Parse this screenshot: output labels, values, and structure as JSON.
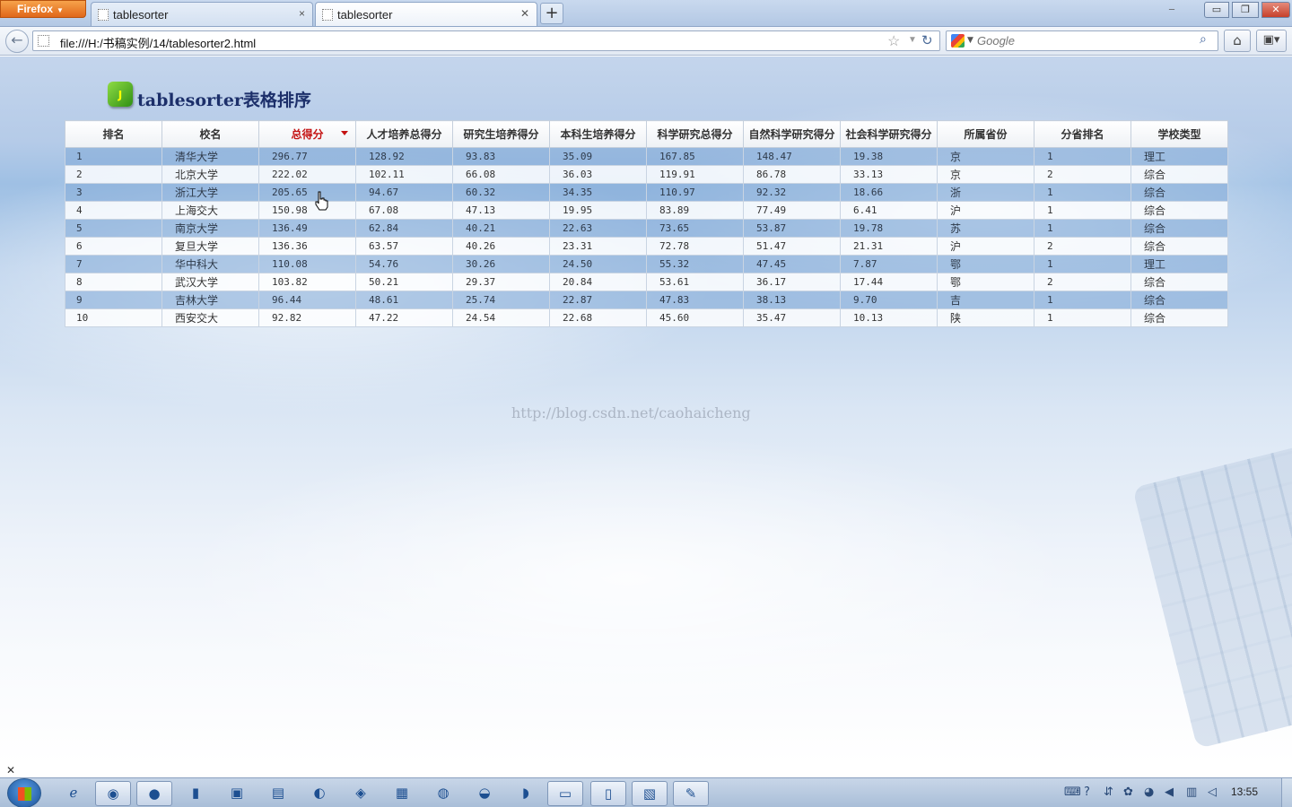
{
  "browser": {
    "app_button": "Firefox",
    "tabs": [
      {
        "label": "tablesorter"
      },
      {
        "label": "tablesorter"
      }
    ],
    "new_tab": "+",
    "url": "file:///H:/书稿实例/14/tablesorter2.html",
    "search_placeholder": "Google",
    "window_controls": {
      "minimize": "▭",
      "maximize": "❐",
      "close": "✕"
    }
  },
  "page": {
    "logo_letter": "J",
    "title": "tablesorter表格排序",
    "watermark": "http://blog.csdn.net/caohaicheng"
  },
  "table": {
    "sorted_column": 2,
    "columns": [
      "排名",
      "校名",
      "总得分",
      "人才培养总得分",
      "研究生培养得分",
      "本科生培养得分",
      "科学研究总得分",
      "自然科学研究得分",
      "社会科学研究得分",
      "所属省份",
      "分省排名",
      "学校类型"
    ],
    "rows": [
      [
        "1",
        "清华大学",
        "296.77",
        "128.92",
        "93.83",
        "35.09",
        "167.85",
        "148.47",
        "19.38",
        "京",
        "1",
        "理工"
      ],
      [
        "2",
        "北京大学",
        "222.02",
        "102.11",
        "66.08",
        "36.03",
        "119.91",
        "86.78",
        "33.13",
        "京",
        "2",
        "综合"
      ],
      [
        "3",
        "浙江大学",
        "205.65",
        "94.67",
        "60.32",
        "34.35",
        "110.97",
        "92.32",
        "18.66",
        "浙",
        "1",
        "综合"
      ],
      [
        "4",
        "上海交大",
        "150.98",
        "67.08",
        "47.13",
        "19.95",
        "83.89",
        "77.49",
        "6.41",
        "沪",
        "1",
        "综合"
      ],
      [
        "5",
        "南京大学",
        "136.49",
        "62.84",
        "40.21",
        "22.63",
        "73.65",
        "53.87",
        "19.78",
        "苏",
        "1",
        "综合"
      ],
      [
        "6",
        "复旦大学",
        "136.36",
        "63.57",
        "40.26",
        "23.31",
        "72.78",
        "51.47",
        "21.31",
        "沪",
        "2",
        "综合"
      ],
      [
        "7",
        "华中科大",
        "110.08",
        "54.76",
        "30.26",
        "24.50",
        "55.32",
        "47.45",
        "7.87",
        "鄂",
        "1",
        "理工"
      ],
      [
        "8",
        "武汉大学",
        "103.82",
        "50.21",
        "29.37",
        "20.84",
        "53.61",
        "36.17",
        "17.44",
        "鄂",
        "2",
        "综合"
      ],
      [
        "9",
        "吉林大学",
        "96.44",
        "48.61",
        "25.74",
        "22.87",
        "47.83",
        "38.13",
        "9.70",
        "吉",
        "1",
        "综合"
      ],
      [
        "10",
        "西安交大",
        "92.82",
        "47.22",
        "24.54",
        "22.68",
        "45.60",
        "35.47",
        "10.13",
        "陕",
        "1",
        "综合"
      ]
    ]
  },
  "taskbar": {
    "clock": "13:55"
  }
}
